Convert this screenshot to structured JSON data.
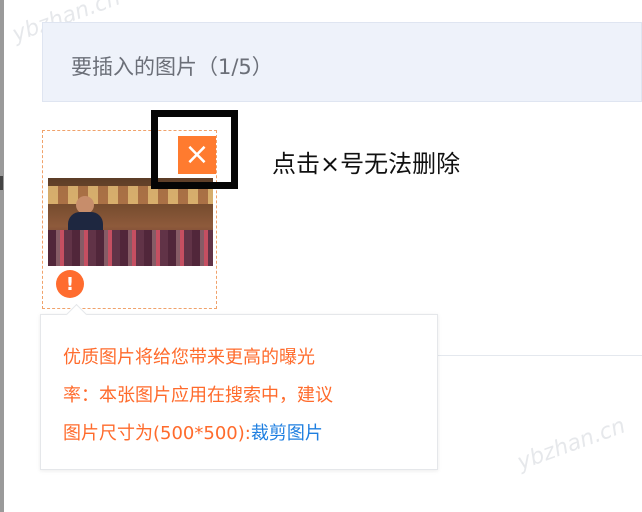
{
  "header": {
    "title": "要插入的图片（1/5）"
  },
  "annotation": {
    "text": "点击×号无法删除"
  },
  "image_card": {
    "close_symbol": "×",
    "warning_symbol": "!"
  },
  "tooltip": {
    "line1": "优质图片将给您带来更高的曝光",
    "line2": "率：本张图片应用在搜索中，建议",
    "line3_prefix": "图片尺寸为(500*500):",
    "crop_link": "裁剪图片"
  },
  "watermark": {
    "text": "ybzhan.cn"
  },
  "colors": {
    "accent_orange": "#ff7b2f",
    "link_blue": "#1f7fe0",
    "header_bg": "#eef2fa"
  }
}
